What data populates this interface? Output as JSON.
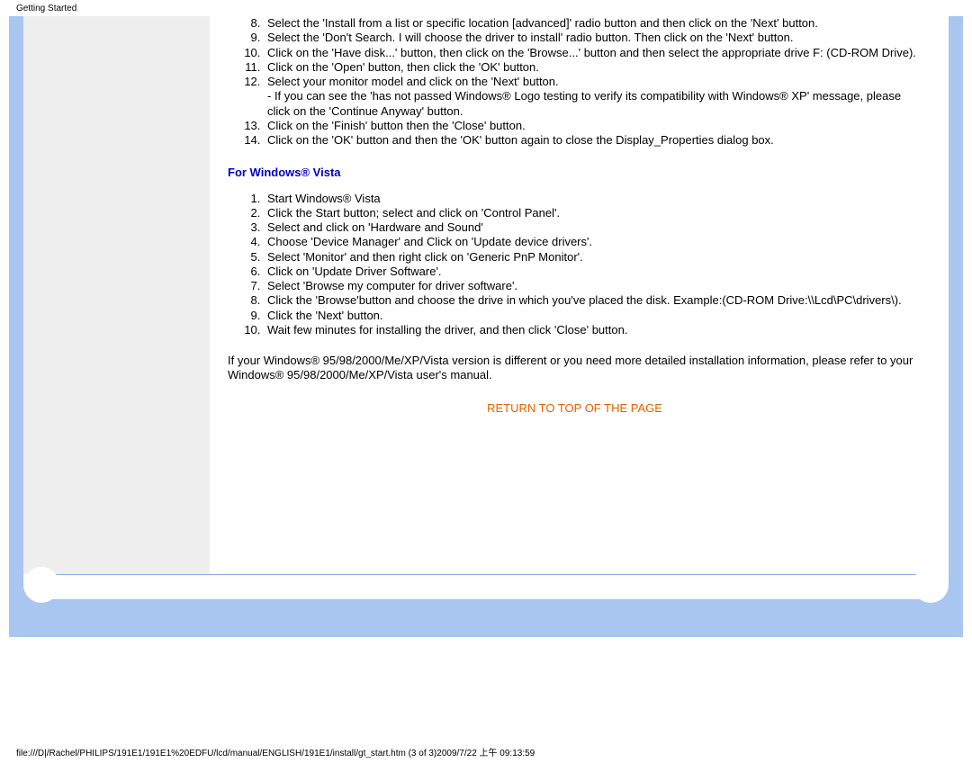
{
  "header": {
    "title": "Getting Started"
  },
  "list1": {
    "start": 8,
    "items": [
      "Select the 'Install from a list or specific location [advanced]' radio button and then click on the 'Next' button.",
      "Select the 'Don't Search. I will choose the driver to install' radio button. Then click on the 'Next' button.",
      "Click on the 'Have disk...' button, then click on the 'Browse...' button and then select the appropriate drive F: (CD-ROM Drive).",
      "Click on the 'Open' button, then click the 'OK' button.",
      "Select your monitor model and click on the 'Next' button.\n- If you can see the 'has not passed Windows® Logo testing to verify its compatibility with Windows® XP' message, please click on the 'Continue Anyway' button.",
      "Click on the 'Finish' button then the 'Close' button.",
      "Click on the 'OK' button and then the 'OK' button again to close the Display_Properties dialog box."
    ]
  },
  "vista_heading": "For Windows® Vista",
  "list2": {
    "start": 1,
    "items": [
      "Start Windows® Vista",
      "Click the Start button; select and click on 'Control Panel'.",
      "Select and click on 'Hardware and Sound'",
      "Choose 'Device Manager' and Click on 'Update device drivers'.",
      "Select 'Monitor' and then right click on 'Generic PnP Monitor'.",
      "Click on 'Update Driver Software'.",
      "Select 'Browse my computer for driver software'.",
      "Click the 'Browse'button and choose the drive in which you've placed the disk. Example:(CD-ROM Drive:\\\\Lcd\\PC\\drivers\\).",
      "Click the 'Next' button.",
      "Wait few minutes for installing the driver, and then click 'Close' button."
    ]
  },
  "paragraph": "If your Windows® 95/98/2000/Me/XP/Vista version is different or you need more detailed installation information, please refer to your Windows® 95/98/2000/Me/XP/Vista user's manual.",
  "return_link": "RETURN TO TOP OF THE PAGE",
  "footer": "file:///D|/Rachel/PHILIPS/191E1/191E1%20EDFU/lcd/manual/ENGLISH/191E1/install/gt_start.htm (3 of 3)2009/7/22 上午 09:13:59"
}
